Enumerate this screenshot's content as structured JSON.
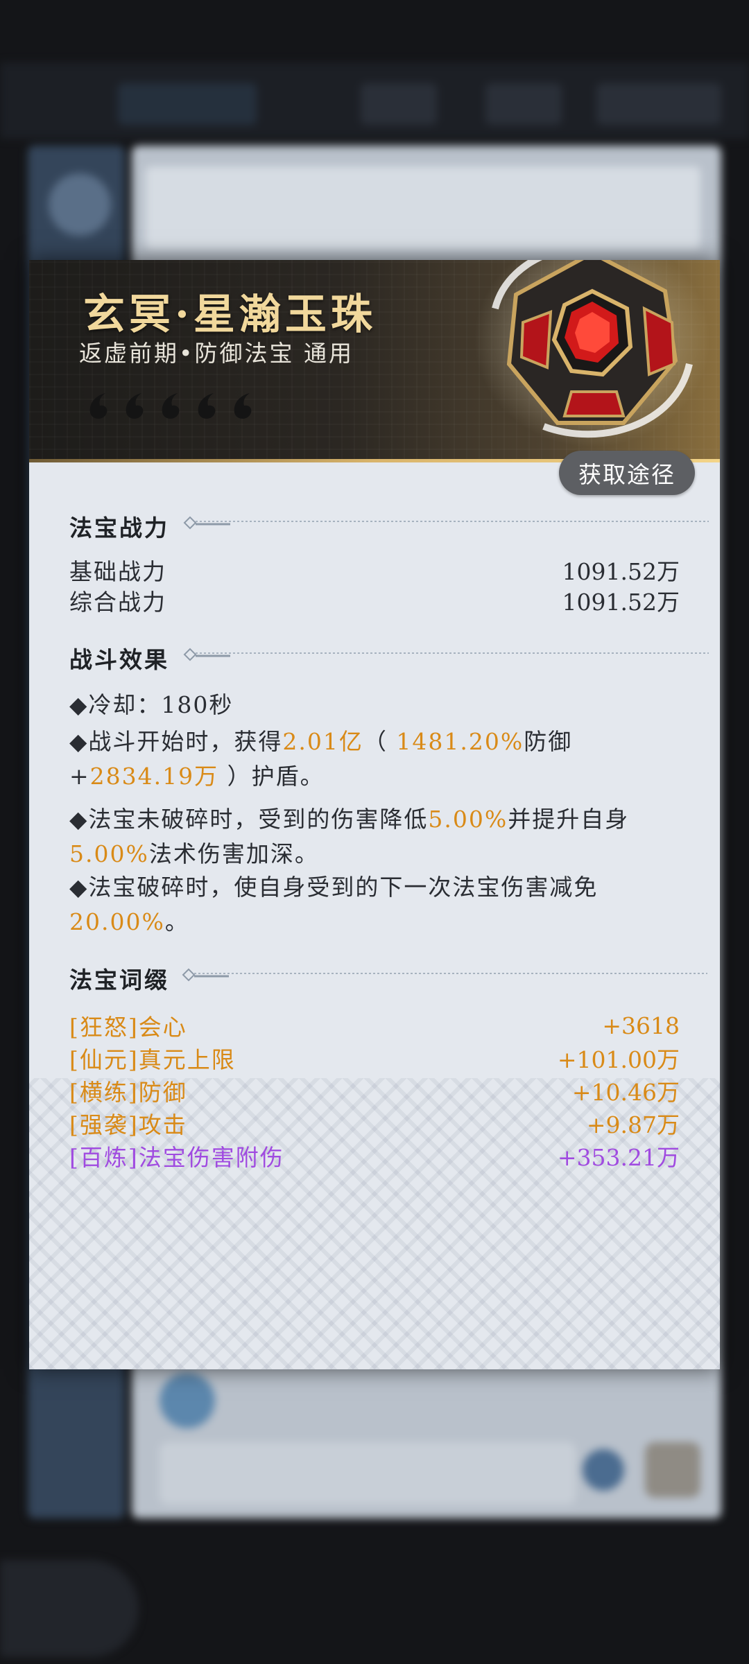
{
  "item": {
    "title": "玄冥·星瀚玉珠",
    "subtitle": "返虚前期•防御法宝 通用",
    "rating": 5
  },
  "source_button": "获取途径",
  "combat_power": {
    "title": "法宝战力",
    "rows": [
      {
        "label": "基础战力",
        "value": "1091.52万"
      },
      {
        "label": "综合战力",
        "value": "1091.52万"
      }
    ]
  },
  "battle_effects": {
    "title": "战斗效果",
    "e1": {
      "text": "◆冷却：180秒"
    },
    "e2": {
      "a": "◆战斗开始时，获得",
      "b": "2.01亿",
      "c": "（ ",
      "d": "1481.20%",
      "e": "防御",
      "f": "+",
      "g": "2834.19万",
      "h": " ）护盾。"
    },
    "e3": {
      "a": "◆法宝未破碎时，受到的伤害降低",
      "b": "5.00%",
      "c": "并提升自身",
      "d": "5.00%",
      "e": "法术伤害加深。"
    },
    "e4": {
      "a": "◆法宝破碎时，使自身受到的下一次法宝伤害减免",
      "b": "20.00%",
      "c": "。"
    }
  },
  "affixes": {
    "title": "法宝词缀",
    "rows": [
      {
        "label": "[狂怒]会心",
        "value": "+3618",
        "color": "#d98a17"
      },
      {
        "label": "[仙元]真元上限",
        "value": "+101.00万",
        "color": "#d98a17"
      },
      {
        "label": "[横练]防御",
        "value": "+10.46万",
        "color": "#d98a17"
      },
      {
        "label": "[强袭]攻击",
        "value": "+9.87万",
        "color": "#d98a17"
      },
      {
        "label": "[百炼]法宝伤害附伤",
        "value": "+353.21万",
        "color": "#a04be0"
      }
    ]
  }
}
